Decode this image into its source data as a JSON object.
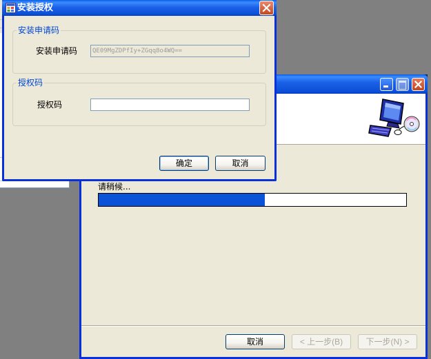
{
  "auth_dialog": {
    "title": "安装授权",
    "request_group": {
      "legend": "安装申请码",
      "label": "安装申请码",
      "value": "QE09MgZDPfIy+ZGqq8o4WQ=="
    },
    "license_group": {
      "legend": "授权码",
      "label": "授权码",
      "value": ""
    },
    "ok_label": "确定",
    "cancel_label": "取消"
  },
  "wizard": {
    "wait_text": "请稍候...",
    "progress_fraction": 0.54,
    "cancel_label": "取消",
    "back_label": "< 上一步(B)",
    "next_label": "下一步(N) >"
  },
  "colors": {
    "title_blue": "#0a4fd6",
    "progress_blue": "#0a53d9",
    "group_legend_blue": "#0046d5",
    "window_face": "#ece9d8"
  },
  "icons": {
    "app": "app-window-icon",
    "close": "close-icon",
    "minimize": "minimize-icon",
    "maximize": "maximize-icon",
    "header_art": "computer-cd-icon"
  }
}
